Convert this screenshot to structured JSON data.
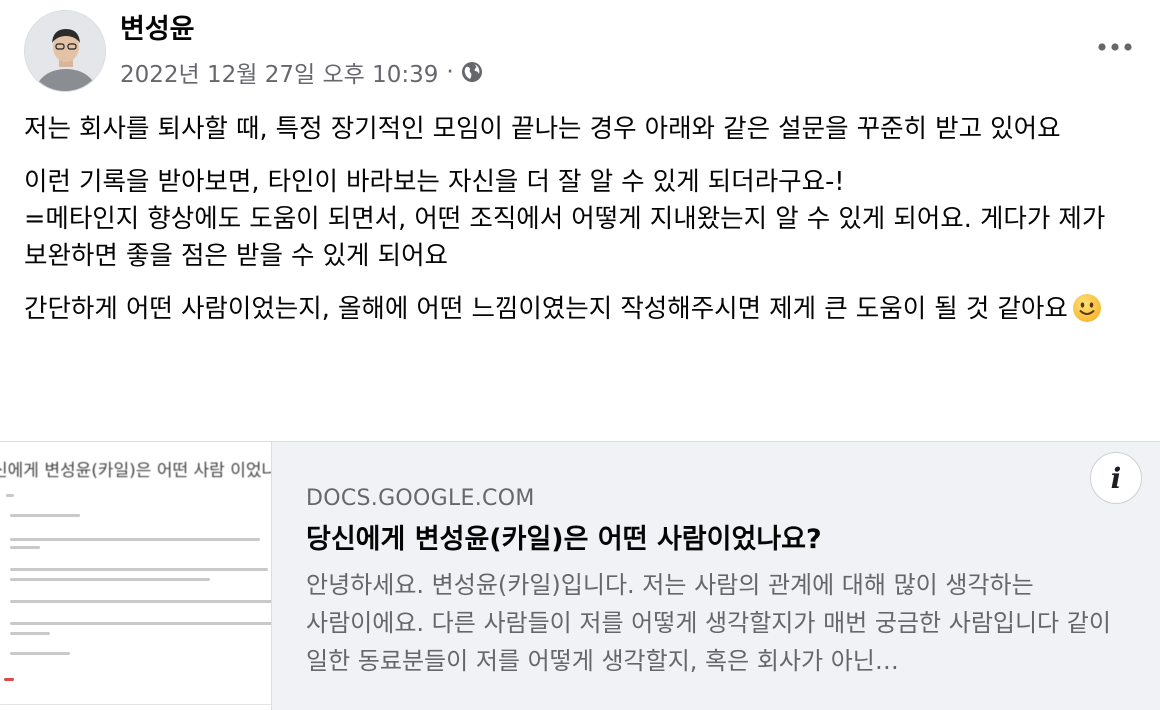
{
  "post": {
    "author": "변성윤",
    "timestamp": "2022년 12월 27일 오후 10:39",
    "separator": "·",
    "privacy_icon": "globe-icon",
    "more_icon": "more-options-icon",
    "paragraphs": [
      "저는 회사를 퇴사할 때, 특정 장기적인 모임이 끝나는 경우 아래와 같은 설문을 꾸준히 받고 있어요",
      "이런 기록을 받아보면, 타인이 바라보는 자신을 더 잘 알 수 있게 되더라구요-!\n=메타인지 향상에도 도움이 되면서, 어떤 조직에서 어떻게 지내왔는지 알 수 있게 되어요. 게다가 제가 보완하면 좋을 점은 받을 수 있게 되어요"
    ],
    "last_paragraph": "간단하게 어떤 사람이었는지, 올해에 어떤 느낌이였는지 작성해주시면 제게 큰 도움이 될 것 같아요",
    "emoji_icon": "smiley-emoji-icon"
  },
  "link_card": {
    "thumbnail_title": "신에게 변성윤(카일)은 어떤 사람 이었나",
    "info_label": "i",
    "domain": "DOCS.GOOGLE.COM",
    "title": "당신에게 변성윤(카일)은 어떤 사람이었나요?",
    "description": "안녕하세요. 변성윤(카일)입니다. 저는 사람의 관계에 대해 많이 생각하는 사람이에요. 다른 사람들이 저를 어떻게 생각할지가 매번 궁금한 사람입니다 같이 일한 동료분들이 저를 어떻게 생각할지, 혹은 회사가 아닌…"
  },
  "colors": {
    "text_primary": "#050505",
    "text_secondary": "#65676b",
    "card_background": "#f0f2f5"
  }
}
